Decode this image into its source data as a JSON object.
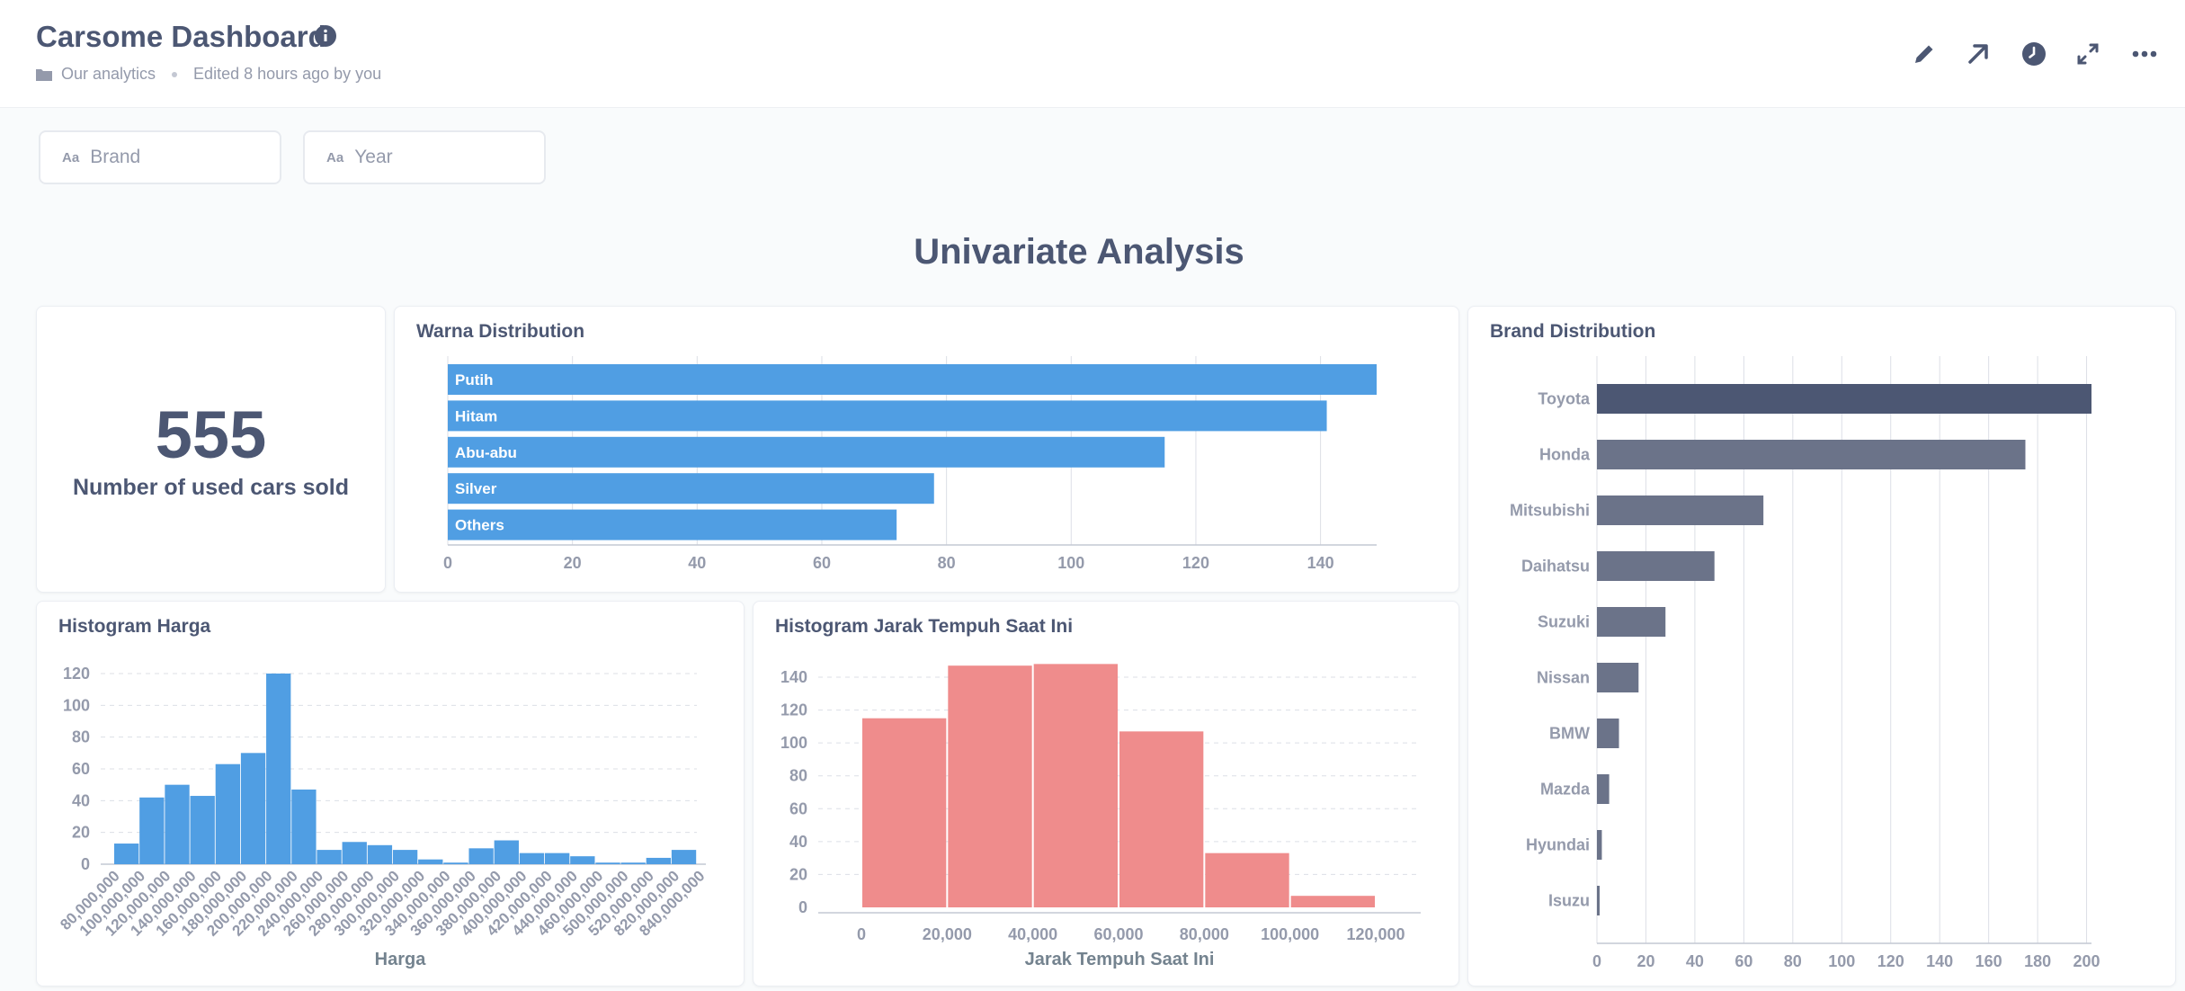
{
  "header": {
    "title": "Carsome Dashboard",
    "collection": "Our analytics",
    "edited": "Edited 8 hours ago by you"
  },
  "filters": [
    {
      "label": "Brand",
      "type_glyph": "Aa"
    },
    {
      "label": "Year",
      "type_glyph": "Aa"
    }
  ],
  "section_title": "Univariate Analysis",
  "scalar": {
    "value": "555",
    "label": "Number of used cars sold"
  },
  "colors": {
    "blue": "#509ee3",
    "red": "#ef8c8c",
    "dark": "#4c5773",
    "muted": "#6b7389"
  },
  "chart_data": [
    {
      "id": "warna",
      "title": "Warna Distribution",
      "type": "bar",
      "orientation": "horizontal",
      "categories": [
        "Putih",
        "Hitam",
        "Abu-abu",
        "Silver",
        "Others"
      ],
      "values": [
        149,
        141,
        115,
        78,
        72
      ],
      "xlim": [
        0,
        149
      ],
      "xticks": [
        0,
        20,
        40,
        60,
        80,
        100,
        120,
        140
      ],
      "color": "#509ee3",
      "grid": true
    },
    {
      "id": "brand",
      "title": "Brand Distribution",
      "type": "bar",
      "orientation": "horizontal",
      "categories": [
        "Toyota",
        "Honda",
        "Mitsubishi",
        "Daihatsu",
        "Suzuki",
        "Nissan",
        "BMW",
        "Mazda",
        "Hyundai",
        "Isuzu"
      ],
      "values": [
        202,
        175,
        68,
        48,
        28,
        17,
        9,
        5,
        2,
        1
      ],
      "xlim": [
        0,
        202
      ],
      "xticks": [
        0,
        20,
        40,
        60,
        80,
        100,
        120,
        140,
        160,
        180,
        200
      ],
      "color_top": "#4c5773",
      "color": "#6b7389",
      "grid": true
    },
    {
      "id": "harga",
      "title": "Histogram Harga",
      "type": "bar",
      "categories": [
        "80,000,000",
        "100,000,000",
        "120,000,000",
        "140,000,000",
        "160,000,000",
        "180,000,000",
        "200,000,000",
        "220,000,000",
        "240,000,000",
        "260,000,000",
        "280,000,000",
        "300,000,000",
        "320,000,000",
        "340,000,000",
        "360,000,000",
        "380,000,000",
        "400,000,000",
        "420,000,000",
        "440,000,000",
        "460,000,000",
        "500,000,000",
        "520,000,000",
        "820,000,000",
        "840,000,000"
      ],
      "values": [
        13,
        42,
        50,
        43,
        63,
        70,
        120,
        47,
        9,
        14,
        12,
        9,
        3,
        1,
        10,
        15,
        7,
        7,
        5,
        1,
        1,
        4,
        9
      ],
      "xlabel": "Harga",
      "ylim": [
        0,
        120
      ],
      "yticks": [
        0,
        20,
        40,
        60,
        80,
        100,
        120
      ],
      "color": "#509ee3",
      "grid": true
    },
    {
      "id": "jarak",
      "title": "Histogram Jarak Tempuh Saat Ini",
      "type": "bar",
      "x_edges": [
        0,
        20000,
        40000,
        60000,
        80000,
        100000,
        120000
      ],
      "values": [
        115,
        147,
        148,
        107,
        33,
        7
      ],
      "xlabel": "Jarak Tempuh Saat Ini",
      "xticks": [
        "0",
        "20,000",
        "40,000",
        "60,000",
        "80,000",
        "100,000",
        "120,000"
      ],
      "ylim": [
        0,
        140
      ],
      "yticks": [
        0,
        20,
        40,
        60,
        80,
        100,
        120,
        140
      ],
      "color": "#ef8c8c",
      "grid": true
    }
  ]
}
